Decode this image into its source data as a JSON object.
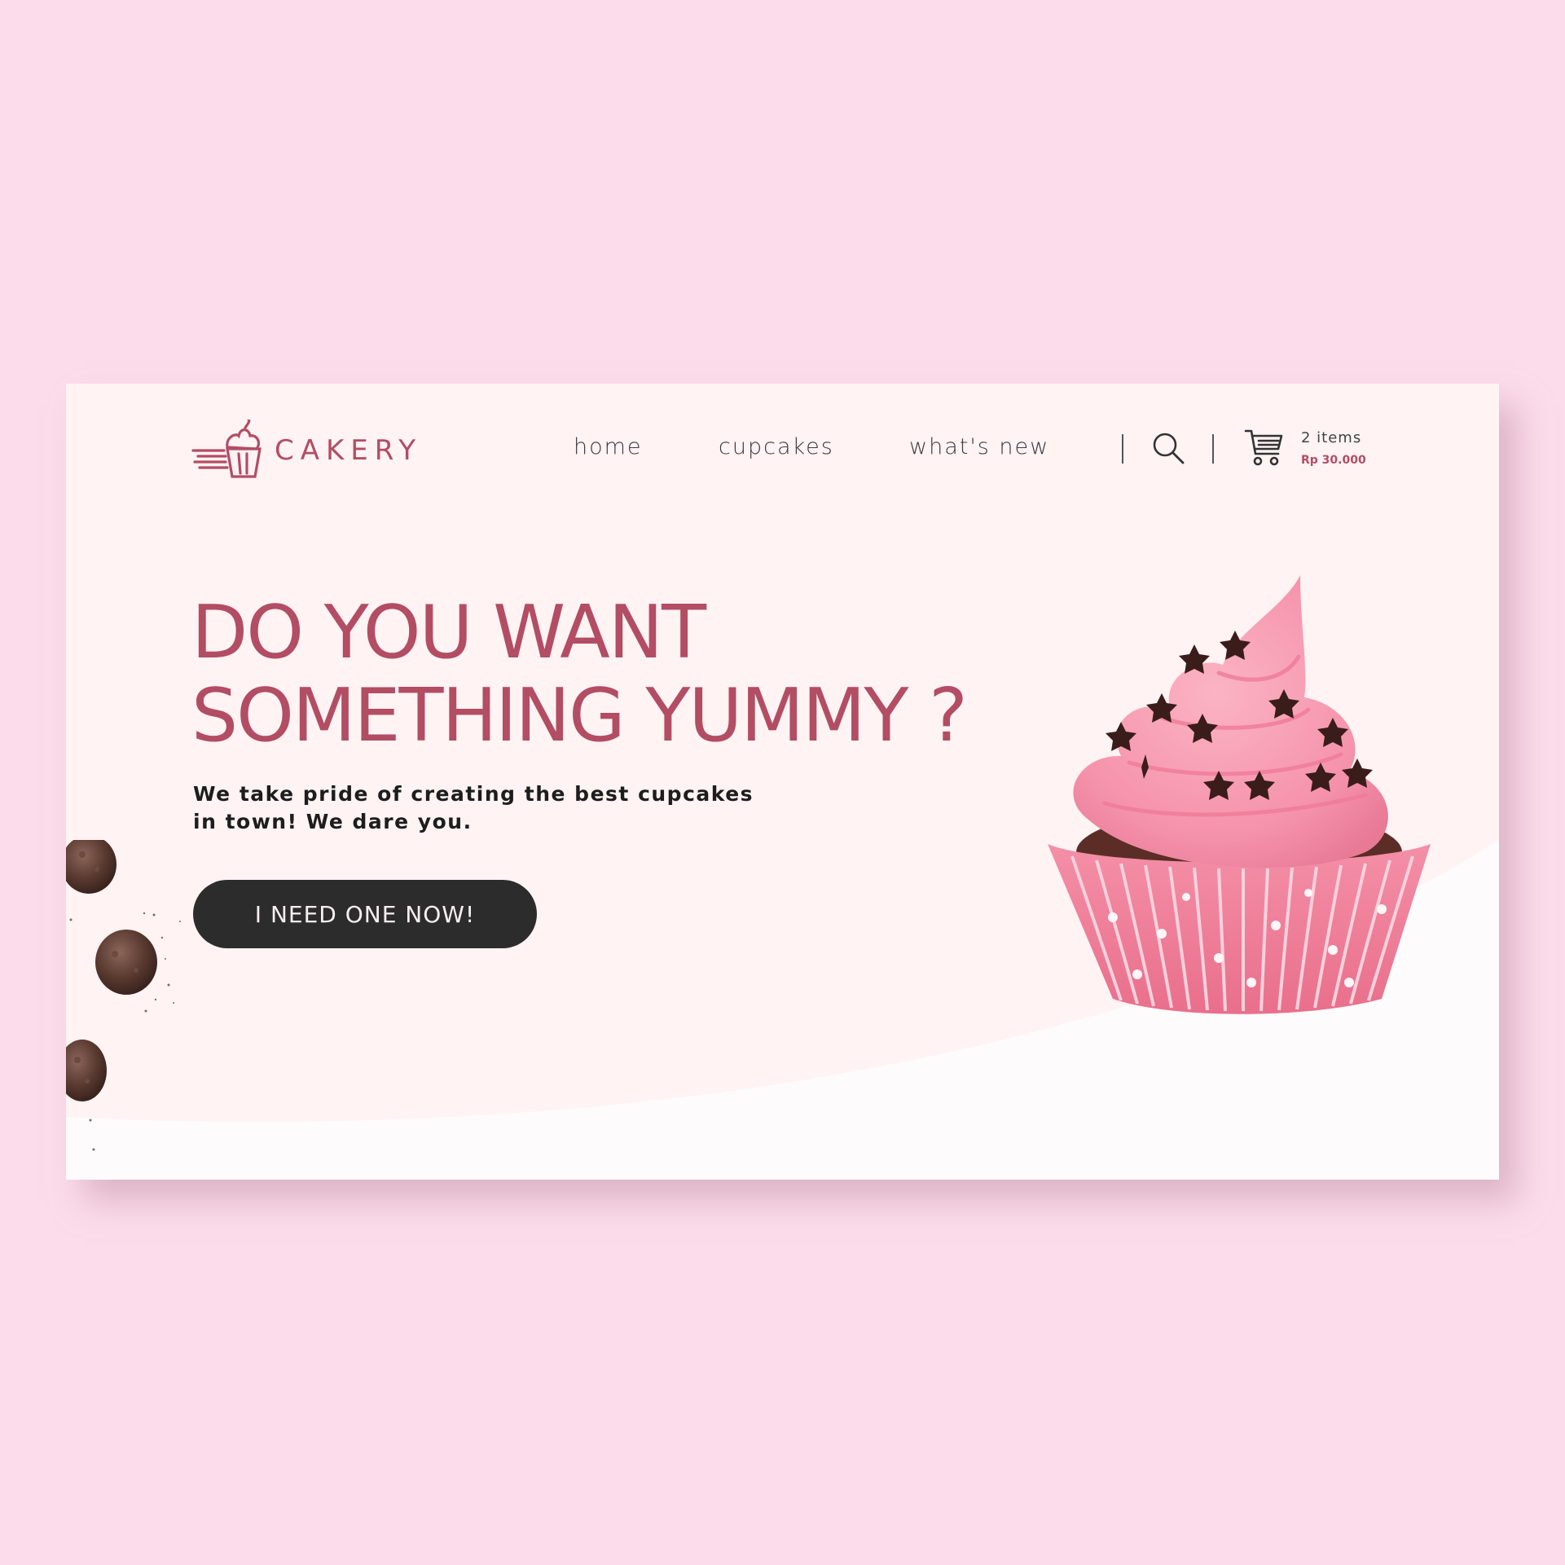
{
  "brand": {
    "name": "CAKERY",
    "color": "#b24d64"
  },
  "nav": {
    "items": [
      "home",
      "cupcakes",
      "what's new"
    ]
  },
  "cart": {
    "count_label": "2 items",
    "total_label": "Rp 30.000"
  },
  "hero": {
    "headline_line1": "DO YOU WANT",
    "headline_line2": "SOMETHING YUMMY ?",
    "subtext_line1": "We take pride of creating the best cupcakes",
    "subtext_line2": "in town! We dare you.",
    "cta_label": "I NEED ONE NOW!"
  },
  "icons": [
    "cupcake-logo-icon",
    "search-icon",
    "cart-icon"
  ],
  "colors": {
    "page_bg": "#fcdcea",
    "card_bg": "#fff3f4",
    "accent": "#b24d64",
    "button": "#2d2c2d"
  }
}
